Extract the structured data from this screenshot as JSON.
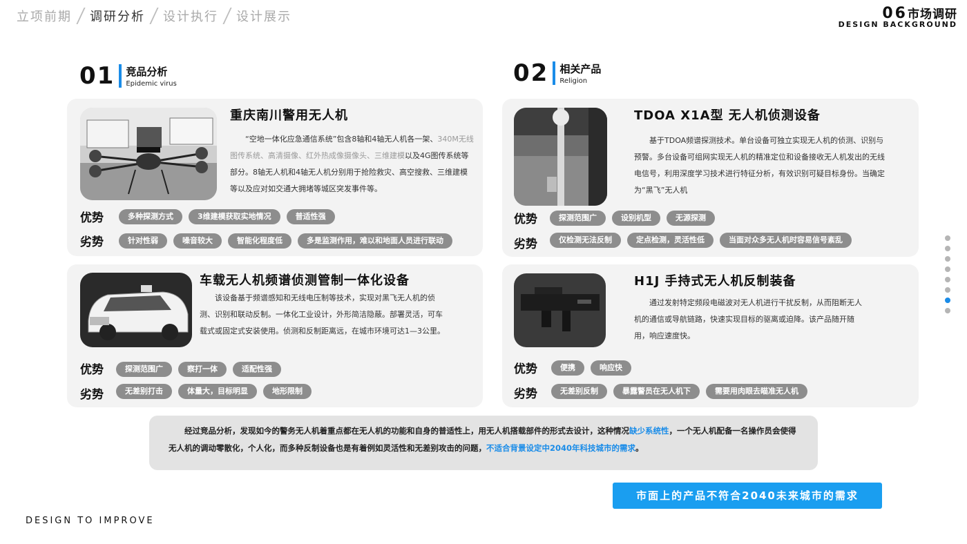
{
  "nav": {
    "items": [
      "立项前期",
      "调研分析",
      "设计执行",
      "设计展示"
    ],
    "active_index": 1
  },
  "header": {
    "number": "06",
    "title": "市场调研",
    "subtitle": "DESIGN BACKGROUND"
  },
  "sections": [
    {
      "number": "01",
      "title": "竞品分析",
      "subtitle": "Epidemic virus"
    },
    {
      "number": "02",
      "title": "相关产品",
      "subtitle": "Religion"
    }
  ],
  "labels": {
    "adv": "优势",
    "disadv": "劣势"
  },
  "cards": [
    {
      "title": "重庆南川警用无人机",
      "desc_a": "“空地一体化应急通信系统”包含8轴和4轴无人机各一架、",
      "desc_grey": "340M无线图传系统、高清摄像、红外热成像摄像头、三维建模",
      "desc_b": "以及4G图传系统等部分。8轴无人机和4轴无人机分别用于抢险救灾、高空搜救、三维建模等以及应对如交通大拥堵等城区突发事件等。",
      "adv": [
        "多种探测方式",
        "3维建模获取实地情况",
        "普适性强"
      ],
      "disadv": [
        "针对性弱",
        "噪音较大",
        "智能化程度低",
        "多是监测作用，难以和地面人员进行联动"
      ]
    },
    {
      "title": "TDOA X1A型 无人机侦测设备",
      "desc": "基于TDOA频谱探测技术。单台设备可独立实现无人机的侦测、识别与预警。多台设备可组网实现无人机的精准定位和设备接收无人机发出的无线电信号，利用深度学习技术进行特征分析，有效识别可疑目标身份。当确定为“黑飞”无人机",
      "adv": [
        "探测范围广",
        "设别机型",
        "无源探测"
      ],
      "disadv": [
        "仅检测无法反制",
        "定点检测，灵活性低",
        "当面对众多无人机时容易信号紊乱"
      ]
    },
    {
      "title": "车载无人机频谱侦测管制一体化设备",
      "desc": "该设备基于频谱感知和无线电压制等技术，实现对黑飞无人机的侦测、识别和联动反制。一体化工业设计，外形简洁隐蔽。部署灵活，可车载式或固定式安装使用。侦测和反制距离远，在城市环境可达1—3公里。",
      "adv": [
        "探测范围广",
        "察打一体",
        "适配性强"
      ],
      "disadv": [
        "无差别打击",
        "体量大，目标明显",
        "地形限制"
      ]
    },
    {
      "title": "H1J 手持式无人机反制装备",
      "desc": "通过发射特定频段电磁波对无人机进行干扰反制，从而阻断无人机的通信或导航链路，快速实现目标的驱离或迫降。该产品随开随用，响应速度快。",
      "adv": [
        "便携",
        "响应快"
      ],
      "disadv": [
        "无差别反制",
        "暴露警员在无人机下",
        "需要用肉眼去瞄准无人机"
      ]
    }
  ],
  "summary": {
    "p1": "经过竞品分析，发现如今的警务无人机着重点都在无人机的功能和自身的普适性上，用无人机搭载部件的形式去设计，这种情况",
    "hl1": "缺少系统性",
    "p2": "，一个无人机配备一名操作员会使得无人机的调动零散化，个人化，而多种反制设备也是有着例如灵活性和无差别攻击的问题，",
    "hl2": "不适合背景设定中2040年科技城市的需求",
    "p3": "。"
  },
  "cta": "市面上的产品不符合2040未来城市的需求",
  "footer": "DESIGN TO IMPROVE",
  "pager": {
    "count": 8,
    "active_index": 6
  },
  "colors": {
    "accent": "#1a8ce8",
    "cta": "#1a9ef0",
    "tag": "#8d8d8d",
    "card": "#f3f3f3"
  }
}
